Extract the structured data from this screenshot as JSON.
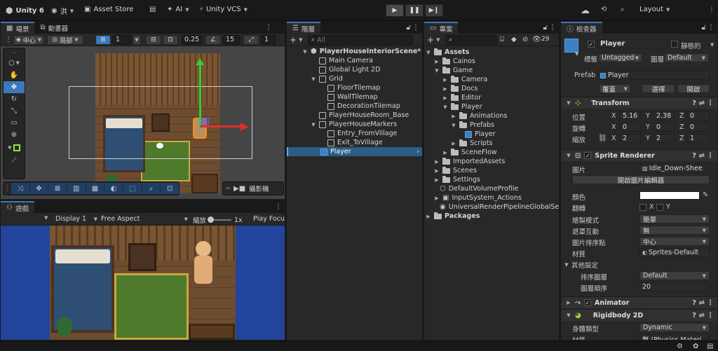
{
  "topbar": {
    "unity_label": "Unity 6",
    "account_label": "洪",
    "asset_store_label": "Asset Store",
    "ai_label": "AI",
    "vcs_label": "Unity VCS",
    "layout_label": "Layout"
  },
  "scene_panel": {
    "tab_scene": "場景",
    "tab_animator": "動畫器",
    "pivot_center": "中心",
    "pivot_local": "局部",
    "grid_value": "1",
    "snap_value": "0.25",
    "angle_value": "15",
    "scale_value": "1",
    "camera_label": "攝影機"
  },
  "game_panel": {
    "tab_game": "遊戲",
    "display": "Display 1",
    "aspect": "Free Aspect",
    "zoom_label": "縮放",
    "zoom_value": "1x",
    "play_focus": "Play Focu"
  },
  "hierarchy": {
    "tab": "階層",
    "search_placeholder": "All",
    "items": [
      {
        "label": "PlayerHouseInteriorScene*"
      },
      {
        "label": "Main Camera"
      },
      {
        "label": "Global Light 2D"
      },
      {
        "label": "Grid"
      },
      {
        "label": "FloorTilemap"
      },
      {
        "label": "WallTilemap"
      },
      {
        "label": "DecorationTilemap"
      },
      {
        "label": "PlayerHouseRoom_Base"
      },
      {
        "label": "PlayerHouseMarkers"
      },
      {
        "label": "Entry_FromVillage"
      },
      {
        "label": "Exit_ToVillage"
      },
      {
        "label": "Player"
      }
    ]
  },
  "project": {
    "tab": "專案",
    "count": "29",
    "items": [
      {
        "label": "Assets"
      },
      {
        "label": "Cainos"
      },
      {
        "label": "Game"
      },
      {
        "label": "Camera"
      },
      {
        "label": "Docs"
      },
      {
        "label": "Editor"
      },
      {
        "label": "Player"
      },
      {
        "label": "Animations"
      },
      {
        "label": "Prefabs"
      },
      {
        "label": "Player"
      },
      {
        "label": "Scripts"
      },
      {
        "label": "SceneFlow"
      },
      {
        "label": "ImportedAssets"
      },
      {
        "label": "Scenes"
      },
      {
        "label": "Settings"
      },
      {
        "label": "DefaultVolumeProfile"
      },
      {
        "label": "InputSystem_Actions"
      },
      {
        "label": "UniversalRenderPipelineGlobalSett"
      },
      {
        "label": "Packages"
      }
    ]
  },
  "inspector": {
    "tab": "檢查器",
    "name": "Player",
    "static_label": "靜態的",
    "tag_label": "標籤",
    "tag_value": "Untagged",
    "layer_label": "圖層",
    "layer_value": "Default",
    "prefab_label": "Prefab",
    "prefab_value": "Player",
    "overrides_label": "覆蓋",
    "select_label": "選擇",
    "open_label": "開啟",
    "transform": {
      "title": "Transform",
      "position_label": "位置",
      "rotation_label": "旋轉",
      "scale_label": "縮放",
      "pos_x": "5.16",
      "pos_y": "2.38",
      "pos_z": "0",
      "rot_x": "0",
      "rot_y": "0",
      "rot_z": "0",
      "scl_x": "2",
      "scl_y": "2",
      "scl_z": "1"
    },
    "sprite_renderer": {
      "title": "Sprite Renderer",
      "sprite_label": "圖片",
      "sprite_value": "Idle_Down-Shee",
      "open_editor_label": "開啟圖片編輯器",
      "color_label": "顏色",
      "flip_label": "翻轉",
      "flip_x": "X",
      "flip_y": "Y",
      "draw_mode_label": "繪製模式",
      "draw_mode_value": "簡單",
      "mask_label": "遮罩互動",
      "mask_value": "無",
      "sort_point_label": "圖片排序點",
      "sort_point_value": "中心",
      "material_label": "材質",
      "material_value": "Sprites-Default",
      "other_label": "其他設定",
      "sorting_layer_label": "排序圖層",
      "sorting_layer_value": "Default",
      "order_label": "圖層順序",
      "order_value": "20"
    },
    "animator_title": "Animator",
    "rigidbody": {
      "title": "Rigidbody 2D",
      "body_type_label": "身體類型",
      "body_type_value": "Dynamic",
      "material_label": "材質",
      "material_value": "無 (Physics Materi"
    }
  },
  "colors": {
    "accent": "#3a79bb",
    "panel_bg": "#282828",
    "game_bg": "#23449b",
    "gizmo_green": "#2fd12f",
    "gizmo_red": "#e0302a"
  }
}
